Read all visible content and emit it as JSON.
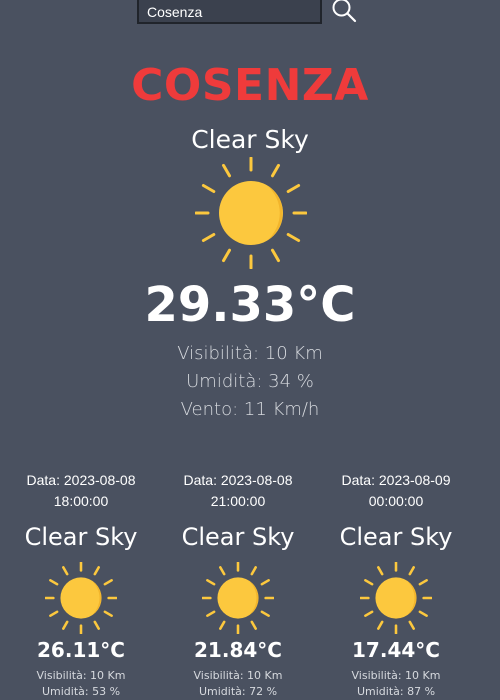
{
  "search": {
    "value": "Cosenza"
  },
  "current": {
    "city": "COSENZA",
    "condition": "Clear Sky",
    "temperature": "29.33°C",
    "visibility": "Visibilità: 10 Km",
    "humidity": "Umidità: 34 %",
    "wind": "Vento: 11 Km/h",
    "icon": "sun-icon"
  },
  "forecast": [
    {
      "date_line": "Data: 2023-08-08",
      "time_line": "18:00:00",
      "condition": "Clear Sky",
      "temperature": "26.11°C",
      "visibility": "Visibilità: 10 Km",
      "humidity": "Umidità: 53 %"
    },
    {
      "date_line": "Data: 2023-08-08",
      "time_line": "21:00:00",
      "condition": "Clear Sky",
      "temperature": "21.84°C",
      "visibility": "Visibilità: 10 Km",
      "humidity": "Umidità: 72 %"
    },
    {
      "date_line": "Data: 2023-08-09",
      "time_line": "00:00:00",
      "condition": "Clear Sky",
      "temperature": "17.44°C",
      "visibility": "Visibilità: 10 Km",
      "humidity": "Umidità: 87 %"
    }
  ],
  "colors": {
    "background": "#4a5160",
    "city": "#ef3b3b",
    "sun": "#fcc83e",
    "text": "#ffffff"
  }
}
